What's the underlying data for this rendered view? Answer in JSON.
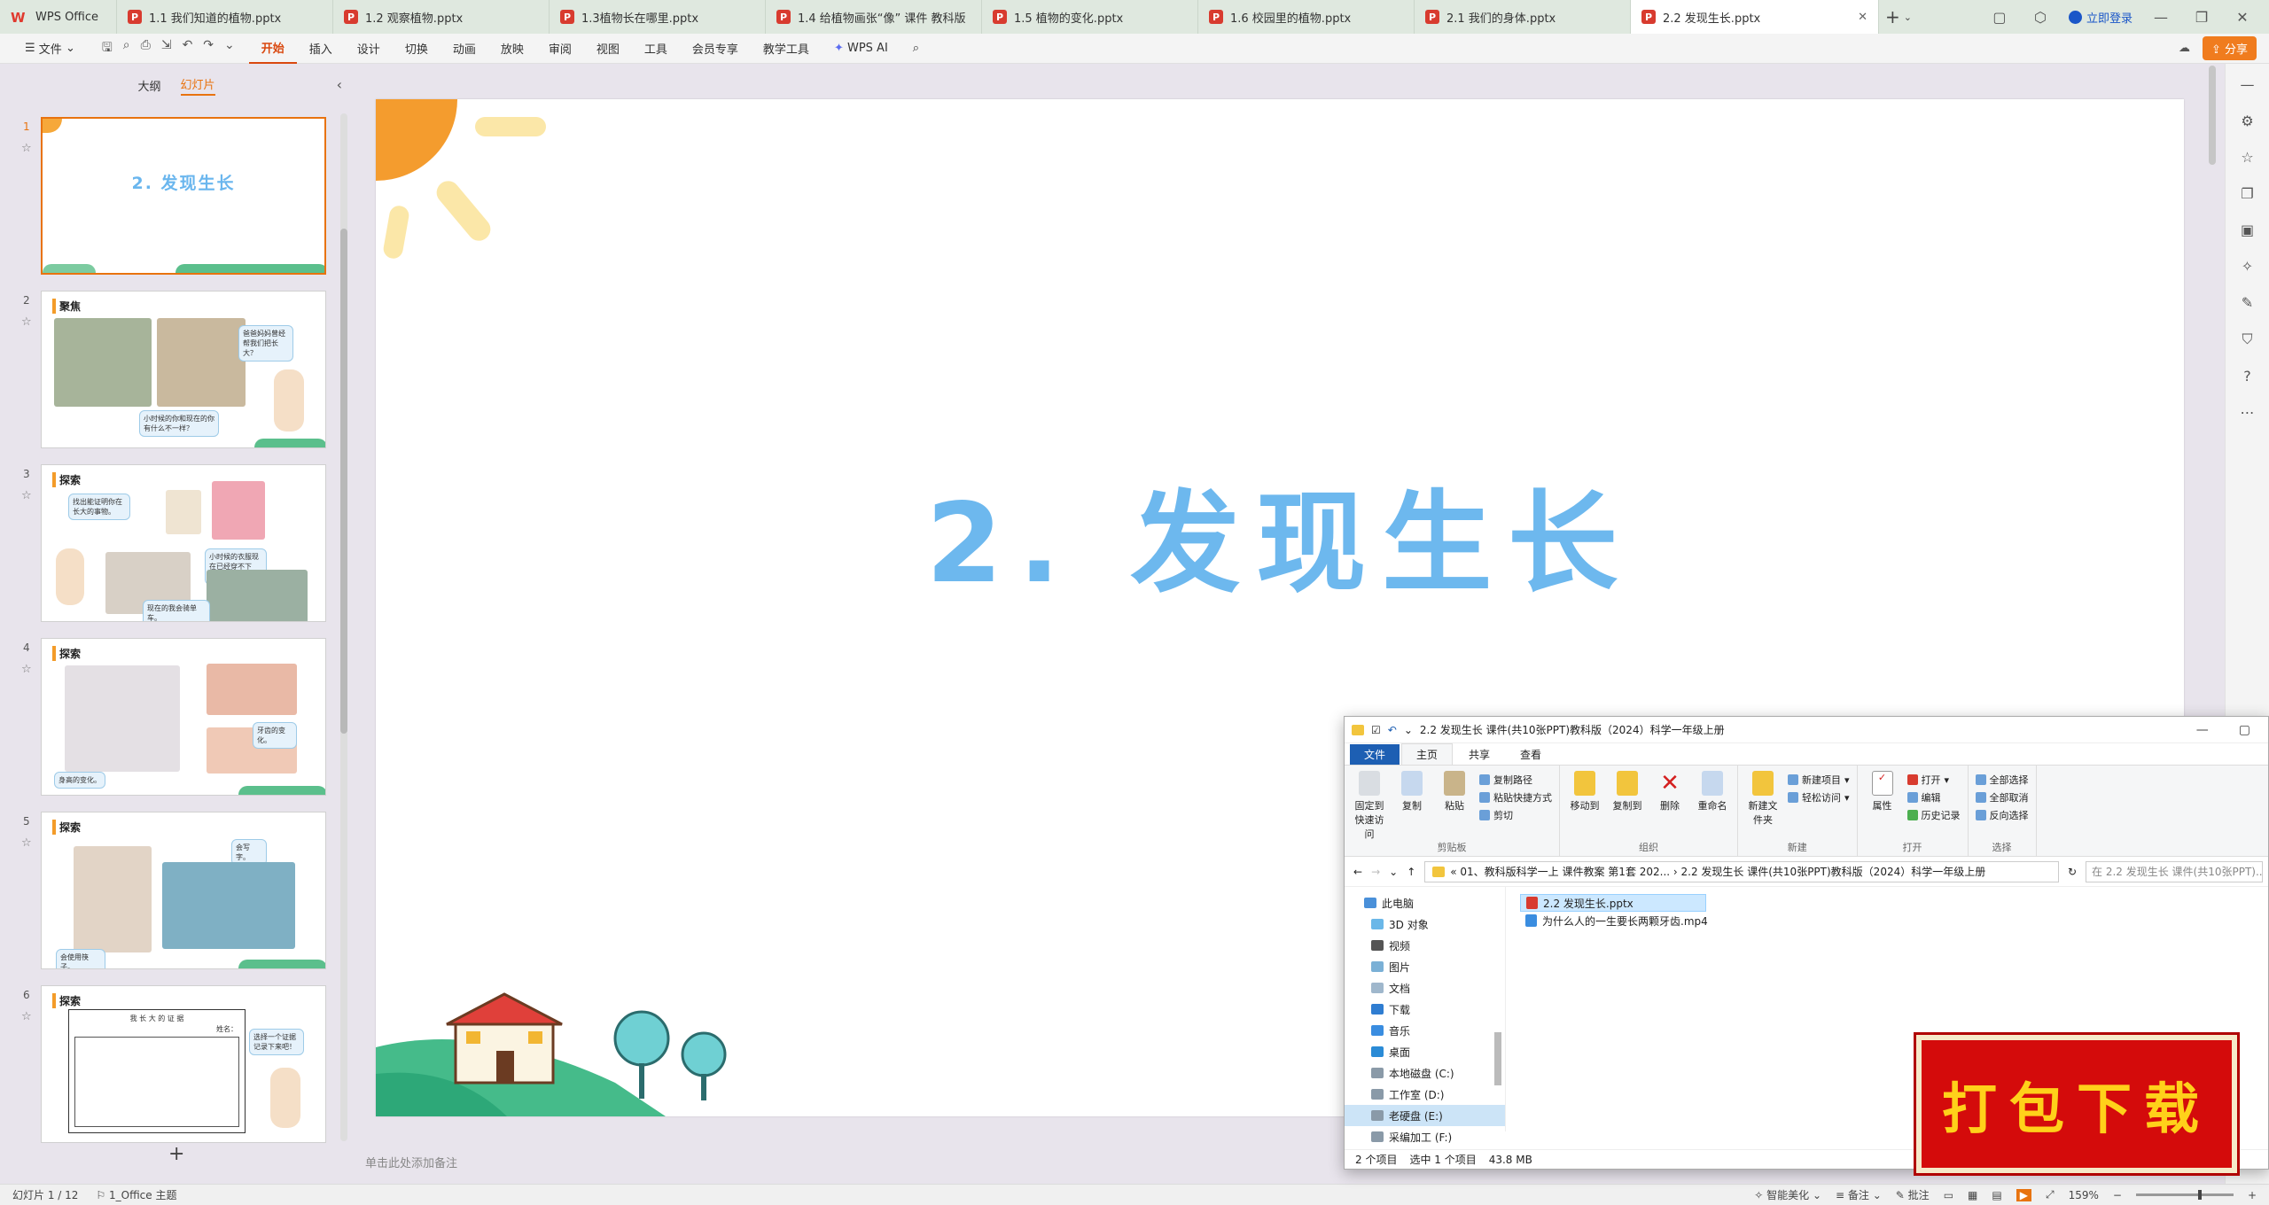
{
  "tabs": [
    {
      "label": "WPS Office",
      "type": "home"
    },
    {
      "label": "1.1 我们知道的植物.pptx"
    },
    {
      "label": "1.2 观察植物.pptx"
    },
    {
      "label": "1.3植物长在哪里.pptx"
    },
    {
      "label": "1.4 给植物画张“像” 课件 教科版"
    },
    {
      "label": "1.5 植物的变化.pptx"
    },
    {
      "label": "1.6 校园里的植物.pptx"
    },
    {
      "label": "2.1 我们的身体.pptx"
    },
    {
      "label": "2.2 发现生长.pptx",
      "active": true
    }
  ],
  "window": {
    "login": "立即登录",
    "share": "分享"
  },
  "menu": {
    "file": "文件",
    "items": [
      "开始",
      "插入",
      "设计",
      "切换",
      "动画",
      "放映",
      "审阅",
      "视图",
      "工具",
      "会员专享",
      "教学工具",
      "WPS AI"
    ],
    "active": "开始"
  },
  "left_pane": {
    "tab_outline": "大纲",
    "tab_slides": "幻灯片",
    "slides": [
      {
        "num": "1",
        "title": "2. 发现生长"
      },
      {
        "num": "2",
        "heading": "聚焦",
        "bubble1": "爸爸妈妈曾经帮我们把长大？",
        "bubble2": "小时候的你和现在的你有什么不一样？"
      },
      {
        "num": "3",
        "heading": "探索",
        "bubble1": "找出能证明你在长大的事物。",
        "bubble2": "小时候的衣服现在已经穿不下了。",
        "bubble3": "现在的我会骑单车。"
      },
      {
        "num": "4",
        "heading": "探索",
        "bubble1": "牙齿的变化。",
        "bubble2": "身高的变化。"
      },
      {
        "num": "5",
        "heading": "探索",
        "bubble1": "会写字。",
        "bubble2": "会使用筷子。"
      },
      {
        "num": "6",
        "heading": "探索",
        "bubble1": "选择一个证据记录下来吧！",
        "chart_title": "我 长 大 的 证 据",
        "chart_name": "姓名："
      }
    ]
  },
  "slide": {
    "title": "2. 发现生长"
  },
  "notes_placeholder": "单击此处添加备注",
  "status": {
    "slide_counter": "幻灯片 1 / 12",
    "theme": "1_Office 主题",
    "beautify": "智能美化",
    "notes": "备注",
    "comments": "批注",
    "zoom": "159%"
  },
  "explorer": {
    "title": "2.2 发现生长 课件(共10张PPT)教科版（2024）科学一年级上册",
    "tabs": [
      "文件",
      "主页",
      "共享",
      "查看"
    ],
    "ribbon": {
      "clipboard": {
        "name": "剪贴板",
        "pin": "固定到快速访问",
        "copy": "复制",
        "paste": "粘贴",
        "copy_path": "复制路径",
        "paste_shortcut": "粘贴快捷方式",
        "cut": "剪切"
      },
      "organize": {
        "name": "组织",
        "move_to": "移动到",
        "copy_to": "复制到",
        "delete": "删除",
        "rename": "重命名"
      },
      "new": {
        "name": "新建",
        "new_folder": "新建文件夹",
        "new_item": "新建项目",
        "easy_access": "轻松访问"
      },
      "open": {
        "name": "打开",
        "properties": "属性",
        "open": "打开",
        "edit": "编辑",
        "history": "历史记录"
      },
      "select": {
        "name": "选择",
        "select_all": "全部选择",
        "select_none": "全部取消",
        "invert": "反向选择"
      }
    },
    "address": "« 01、教科版科学一上 课件教案 第1套 202... › 2.2 发现生长 课件(共10张PPT)教科版（2024）科学一年级上册",
    "search_placeholder": "在 2.2 发现生长 课件(共10张PPT)...",
    "nav": [
      {
        "label": "此电脑",
        "level": 0
      },
      {
        "label": "3D 对象",
        "level": 1
      },
      {
        "label": "视频",
        "level": 1
      },
      {
        "label": "图片",
        "level": 1
      },
      {
        "label": "文档",
        "level": 1
      },
      {
        "label": "下载",
        "level": 1
      },
      {
        "label": "音乐",
        "level": 1
      },
      {
        "label": "桌面",
        "level": 1
      },
      {
        "label": "本地磁盘 (C:)",
        "level": 1
      },
      {
        "label": "工作室 (D:)",
        "level": 1
      },
      {
        "label": "老硬盘 (E:)",
        "level": 1,
        "selected": true
      },
      {
        "label": "采编加工 (F:)",
        "level": 1
      }
    ],
    "files": [
      {
        "name": "2.2 发现生长.pptx",
        "type": "pptx",
        "selected": true
      },
      {
        "name": "为什么人的一生要长两颗牙齿.mp4",
        "type": "mp4"
      }
    ],
    "status_count": "2 个项目",
    "status_selected": "选中 1 个项目",
    "status_size": "43.8 MB"
  },
  "badge": {
    "text": "打包下载"
  },
  "colors": {
    "accent": "#e8730f",
    "title_blue": "#6db8ee",
    "badge_red": "#d40b0b",
    "badge_text": "#ffd11a"
  }
}
